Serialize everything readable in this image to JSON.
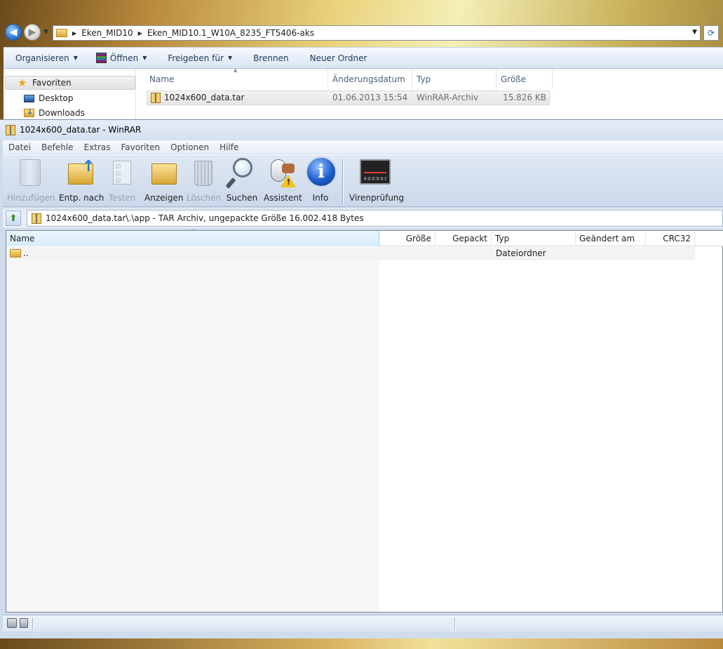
{
  "explorer": {
    "breadcrumbs": [
      "Eken_MID10",
      "Eken_MID10.1_W10A_8235_FT5406-aks"
    ],
    "commands": [
      {
        "label": "Organisieren",
        "dropdown": true,
        "icon": ""
      },
      {
        "label": "Öffnen",
        "dropdown": true,
        "icon": "winrar-icon"
      },
      {
        "label": "Freigeben für",
        "dropdown": true,
        "icon": ""
      },
      {
        "label": "Brennen",
        "dropdown": false,
        "icon": ""
      },
      {
        "label": "Neuer Ordner",
        "dropdown": false,
        "icon": ""
      }
    ],
    "nav": {
      "favorites": "Favoriten",
      "desktop": "Desktop",
      "downloads": "Downloads"
    },
    "columns": {
      "name": "Name",
      "date": "Änderungsdatum",
      "type": "Typ",
      "size": "Größe"
    },
    "file": {
      "name": "1024x600_data.tar",
      "date": "01.06.2013 15:54",
      "type": "WinRAR-Archiv",
      "size": "15.826 KB"
    }
  },
  "winrar": {
    "title": "1024x600_data.tar - WinRAR",
    "menu": [
      "Datei",
      "Befehle",
      "Extras",
      "Favoriten",
      "Optionen",
      "Hilfe"
    ],
    "toolbar": {
      "add": "Hinzufügen",
      "extract": "Entp. nach",
      "test": "Testen",
      "view": "Anzeigen",
      "delete": "Löschen",
      "find": "Suchen",
      "wizard": "Assistent",
      "info": "Info",
      "virus": "Virenprüfung"
    },
    "path": "1024x600_data.tar\\.\\app - TAR Archiv, ungepackte Größe 16.002.418 Bytes",
    "columns": {
      "name": "Name",
      "size": "Größe",
      "packed": "Gepackt",
      "type": "Typ",
      "modified": "Geändert am",
      "crc": "CRC32"
    },
    "rows": [
      {
        "name": "..",
        "type": "Dateiordner"
      }
    ]
  }
}
